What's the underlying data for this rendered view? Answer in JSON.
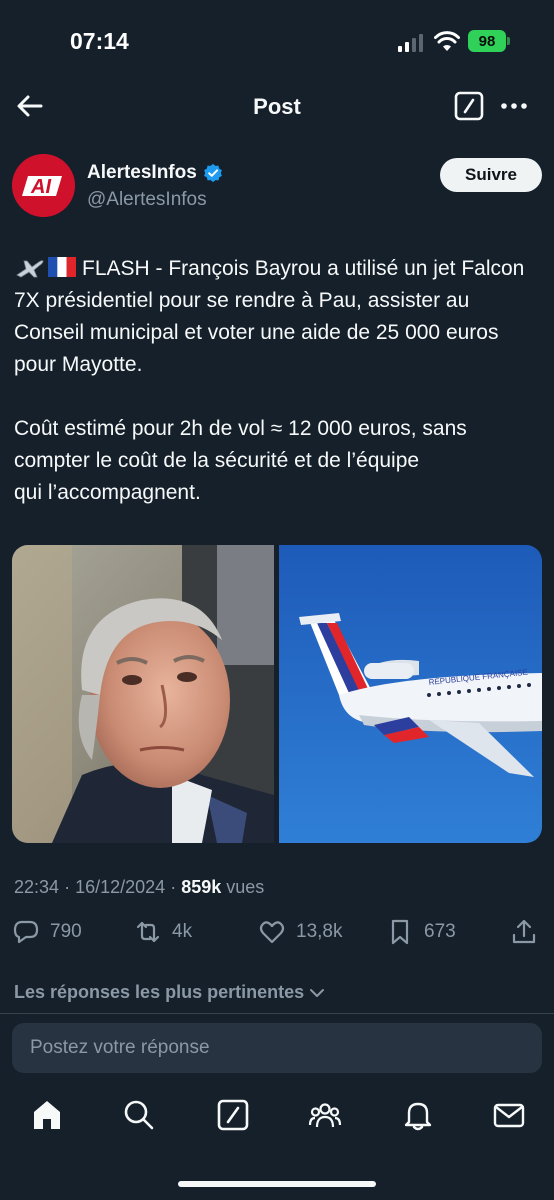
{
  "status_bar": {
    "time": "07:14",
    "battery": "98"
  },
  "header": {
    "title": "Post"
  },
  "author": {
    "name": "AlertesInfos",
    "handle": "@AlertesInfos",
    "avatar_text": "AI",
    "follow_label": "Suivre"
  },
  "tweet": {
    "flash_text": "FLASH - François Bayrou a utilisé un jet Falcon 7X présidentiel pour se rendre à Pau, assister au Conseil municipal et voter une aide de 25 000 euros pour Mayotte.",
    "cost_text_line1": "Coût estimé pour 2h de vol ≈ 12 000 euros, sans compter le coût de la sécurité et de l’équipe",
    "cost_text_line2": "qui l’accompagnent.",
    "plane_livery_text": "RÉPUBLIQUE FRANÇAISE"
  },
  "meta": {
    "time": "22:34",
    "date": "16/12/2024",
    "views_count": "859k",
    "views_label": "vues"
  },
  "actions": {
    "replies": "790",
    "retweets": "4k",
    "likes": "13,8k",
    "bookmarks": "673"
  },
  "replies_sort": {
    "label": "Les réponses les plus pertinentes"
  },
  "reply_input": {
    "placeholder": "Postez votre réponse"
  },
  "colors": {
    "background": "#15202b",
    "accent": "#1d9bf0",
    "muted": "#8b98a5"
  },
  "icons": {
    "back": "arrow-left-icon",
    "compose": "compose-icon",
    "more": "more-horizontal-icon",
    "reply": "reply-icon",
    "retweet": "retweet-icon",
    "like": "heart-icon",
    "bookmark": "bookmark-icon",
    "share": "share-icon",
    "home": "home-icon",
    "search": "search-icon",
    "grok": "grok-icon",
    "communities": "communities-icon",
    "notifications": "bell-icon",
    "messages": "mail-icon"
  }
}
